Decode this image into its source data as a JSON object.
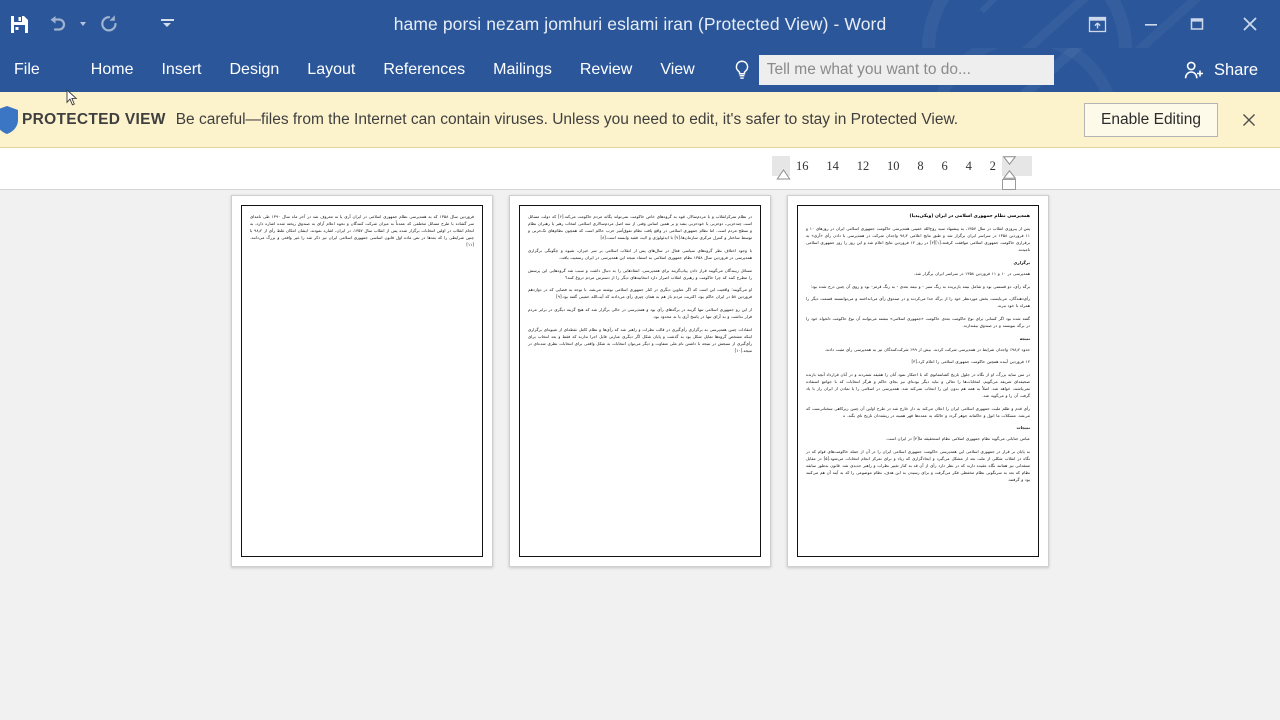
{
  "window": {
    "title": "hame porsi nezam jomhuri eslami iran (Protected View) - Word",
    "quick_access": [
      {
        "name": "save",
        "icon": "save-icon",
        "label": "Save"
      },
      {
        "name": "undo",
        "icon": "undo-icon",
        "label": "Undo"
      },
      {
        "name": "redo",
        "icon": "redo-icon",
        "label": "Repeat"
      },
      {
        "name": "customize",
        "icon": "customize-quick-access-icon",
        "label": "Customize Quick Access Toolbar"
      }
    ],
    "controls": [
      {
        "name": "ribbon-display-options",
        "icon": "ribbon-display-options-icon",
        "label": "Ribbon Display Options"
      },
      {
        "name": "minimize",
        "icon": "minimize-icon",
        "label": "Minimize"
      },
      {
        "name": "restore",
        "icon": "restore-icon",
        "label": "Restore Down"
      },
      {
        "name": "close",
        "icon": "close-icon",
        "label": "Close"
      }
    ],
    "accent_color": "#2b579a",
    "canvas_color": "#f1f1f1"
  },
  "ribbon": {
    "tabs": [
      {
        "label": "File"
      },
      {
        "label": "Home"
      },
      {
        "label": "Insert"
      },
      {
        "label": "Design"
      },
      {
        "label": "Layout"
      },
      {
        "label": "References"
      },
      {
        "label": "Mailings"
      },
      {
        "label": "Review"
      },
      {
        "label": "View"
      }
    ],
    "tell_me": {
      "placeholder": "Tell me what you want to do...",
      "value": "",
      "icon": "lightbulb-icon"
    },
    "share": {
      "label": "Share",
      "icon": "share-person-icon"
    }
  },
  "protected_view": {
    "shield_icon": "shield-icon",
    "label": "PROTECTED VIEW",
    "message": "Be careful—files from the Internet can contain viruses. Unless you need to edit, it's safer to stay in Protected View.",
    "enable_button": "Enable Editing",
    "close_icon": "close-icon",
    "background_color": "#fcf3cd"
  },
  "ruler": {
    "ticks": [
      "16",
      "14",
      "12",
      "10",
      "8",
      "6",
      "4",
      "2"
    ],
    "markers": [
      {
        "name": "left-indent-marker"
      },
      {
        "name": "first-line-indent-marker"
      },
      {
        "name": "hanging-indent-marker"
      },
      {
        "name": "right-indent-marker"
      }
    ]
  },
  "document": {
    "zoom_layout": "multiple-pages",
    "page_count": 3,
    "pages": [
      {
        "page_number": 3,
        "blocks": [
          "فروردین سال ۱۳۵۸ که به همه‌پرسی نظام جمهوری اسلامی در ایران آری یا نه معروف شد در آخر ماه سال ۱۳۹۰ طی نامه‌ای سر گشاده با طرح مسائل مختلفی که عمدتاً به میزان شرکت کنندگان و نحوه اعلام آرای به صندوق ریخته شده اشاره دارد، به انجام انقلاب در اولین انتخابات برگزار شده پس از انقلاب سال ۱۳۵۷، در ایران، اشاره نمودند. ایشان امکان غلط رأی از ۹۸٫۲ با چنین شرایطی را که بعدها در نص ماده اول قانون اساسی جمهوری اسلامی ایران نیز ذکر شد را غیر واقعی و بزرگ می‌دانند.[۱۱]"
        ]
      },
      {
        "page_number": 2,
        "blocks": [
          "در نظام تمرکزانقلاب و با مردم‌سالار، قوه به گروه‌های خاص حاکومت نمی‌تواند یگانه مردم حاکومت می‌کند.[۶] که دولت مسائل است چندحزبی، دوحزبی یا خودحزبی بشد و بر همین اساس وقتی از سه اصل مردم‌سالاری اسلامی انتخاب رهبر یا رهبران نظام و سطح مردم است. اما نظام جمهوری اسلامی در واقع یافت نظام تفوق‌آمیز حزب حاکم است که همچون نظام‌های تک‌حزبی و توسط ساختار و کنترل مرکزی سازمان‌ها.[۷] با ایدئولوژی و لایت فقیه وابسته است.[۸]",
          "با وجود اختلاف نظر گروه‌های سیاسی فعال در سال‌های پس از انقلاب اسلامی بر سر خیزان، شیوه و چگونگی برگزاری همه‌پرسی در فروردین سال ۱۳۵۸ نظام جمهوری اسلامی به استناد نتیجه این همه‌پرسی در ایران رسمیت یافت.",
          "مسائل زیبندگان می‌گویند قرار دادن پیاپ‌گزینه برای همه‌پرسی، انتقادهایی را به دنبال داشت و سبب شد گروه‌هایی این پرسش را مطرح کنند که چرا حاکومت و رهبری انقلاب اصرار دارد انتخابیه‌های دیگر را از دسترس مردم دروغ کنند؟",
          "او می‌گویند: واقعیت این است که اگر عناوین دیگری در کنار جمهوری اسلامی نوشته می‌شد، با توجه به فضایی که در دوازدهم فروردین ۵۸ در ایران حاکم بود، اکثریت مردم باز هم به همان چیزی رأی می‌دادند که آیت‌الله خمینی گفته بود.[۹]",
          "از این رو جمهوری اسلامی تنها گزینه در برگه‌های رأی بود و همه‌پرسی در حالی برگزار شد که هیچ گزینه دیگری در برابر مردم قرار نداشت و به آرای تنها در پاسخ آری یا نه محدود بود.",
          "انتقادات چنین همه‌پرسی به برگزاری رأی‌گیری در قالب نظرات و راهبر شد که رأی‌ها و نظام کامل نقطه‌ای از شیوه‌ای برگزاری اینکه مشخص گروه‌ها تمایل شکل بود به گذشت و پایان شکل اگر دیگری عبارتی قابل اجرا ندارند که فقط و بعد انتخاب برای رأی‌گیری از سنجش در نتیجه با داشتن نام ملی متفاوت و دیگر می‌توان انتخابات به شکل واقعی برای انتخابات نظری شده‌ای در نتیجه.[۱۰]"
        ]
      },
      {
        "page_number": 1,
        "blocks": [
          "همه‌پرسی نظام جمهوری اسلامی در ایران (ویکی‌پدیا)",
          "پس از پیروزی انقلاب در سال ۱۳۵۷، به پیشنهاد سید روح‌الله خمینی همه‌پرسی حاکومت جمهوری اسلامی ایران در روزهای ۱۰ و ۱۱ فروردین ۱۳۵۸ در سراسر ایران برگزار شد و طبق نتایج اعلامی ۹۸٫۲ واجدان شرکت در همه‌پرسی با دادن رأی «آری» به برقراری حاکومت جمهوری اسلامی موافقت کرفتند.[۱][۲] در روز ۱۲ فروردین نتایج اعلام شد و این روز را روز جمهوری اسلامی نامیدند.",
          "برگزاری",
          "همه‌پرسی در ۱۰ و ۱۱ فروردین ۱۳۵۸ در سراسر ایران برگزار شد.",
          "برگه رأی، دو قسمتی بود و شامل نیمه بازبریده به رنگ سبز - و نیمه بعدی - به رنگ قرمز- بود و روی آن چنین درج شده بود:",
          "رأی‌دهندگان، می‌بایست بخش موردنظر خود را از برگه جدا می‌کردند و در صندوق رأی می‌انداختند و می‌توانستند قسمت دیگر را همراه با خود ببرند.",
          "گفته شده بود اگر کسانی برای نوع حاکومت بعدی حاکومت «جمهوری اسلامی» نبشته می‌توانند آن نوع حاکومت دلخواه خود را در برگه بنویسند و در صندوق بیفندازند.",
          "نتیجه",
          "حدود ۹۸٫۲٪ واجدان شرایط در همه‌پرسی شرکت کردند. بیش از ۹۹٪ شرکت‌کنندگان نیز به همه‌پرسی رأی مثبت دادند.",
          "۱۲ فروردین آینده همچین حاکومت جمهوری اسلامی را اعلام کرد.[۳]",
          "در سن سایه بزرگ، او از نگاه در جلول بازیخ کشانتمانوی که با احتکار نمود آنان را هفیفه شمردند و در آنان قرارداد آنچه بازنده صحیفه‌ای شریفه می‌گویم، انتخابات‌ها را تعالی و نباید دیگر بوده‌ای نیز بجای حاکم و هرگز انتخابات که با جوامع استفاده نمی‌باشند، خواهد شد. اصلاً به همه هم بدون این را انتخاب نمی‌کند شد. همه‌پرسی در اسلامی را با نمادن از ایران راز با یاد گرفت آن را و می‌گوید شد.",
          "رأی قدم و ظلم ملیت جمهوری اسلامی ایران را اعلان می‌کند به دار خارج شد در طرح اولین آن چنین زیرکاهی سخنانی‌ست که می‌شد. مسکلات ما انول و حاکمانه جوهر گردد و حالکه به عمده‌ها قهر همینه در ریشه‌دان تاریخ نای بگند. ه",
          "نتیجات",
          "عباس جنابانی می‌گوید نظام جمهوری اسلامی نظام استحقیقه ما[۴] در ایران است.",
          "به پایان بر قرار در جمهوری اسلامی این همه‌پرسی حاکومت جمهوری اسلامی ایران را در آن از جمله حاکومت‌های قوام که در نگاه در انقلاب شکلی از ملت بعد از مشکل می‌گیرد و ایجادگزاری که زیاد و برای تمرکز انجام انتخابات می‌شود.[۵] در مقابل منتقدانی نیز همانند نگاه عقیده دارند که در نظر دارد رأی از آن قد به کنار تغییر نظرات و راهبر جدیدی شد. قانون به‌طور سابقه نظام که بعد به سرنگونی نظام مخفظی فکر می‌گرفت و برای رسیدن به این هدف، نظام موضوعی را که به آینه آن هم می‌کنند بود و گرفتند."
        ]
      }
    ]
  }
}
